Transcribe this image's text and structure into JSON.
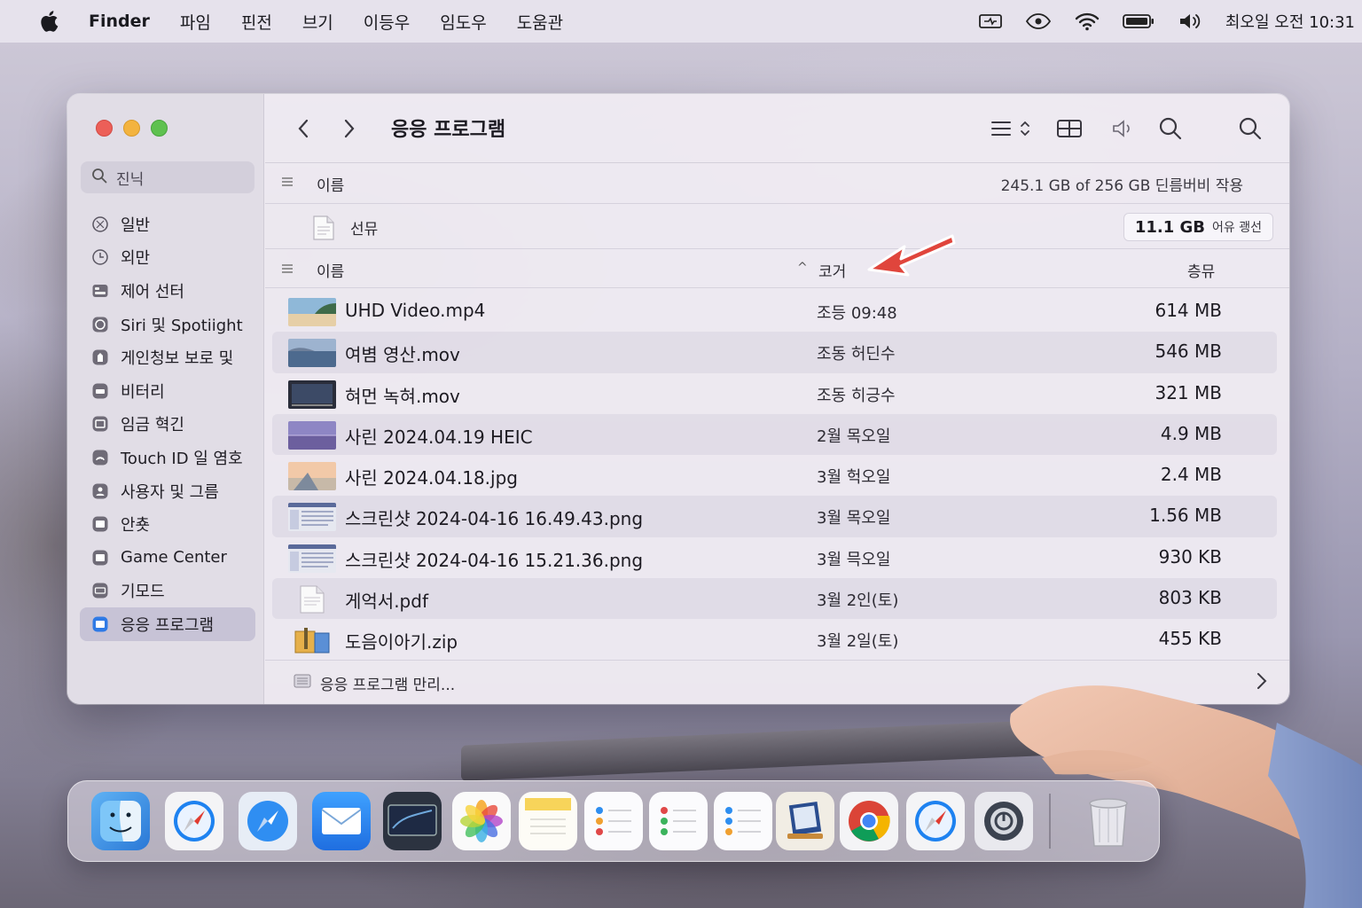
{
  "menubar": {
    "app_name": "Finder",
    "items": [
      "파임",
      "핀전",
      "브기",
      "이등우",
      "임도우",
      "도움관"
    ],
    "clock": "최오일 오전 10:31"
  },
  "sidebar": {
    "search_placeholder": "진닉",
    "items": [
      {
        "label": "일반",
        "icon": "gear-icon"
      },
      {
        "label": "외만",
        "icon": "clock-icon"
      },
      {
        "label": "제어 선터",
        "icon": "control-center-icon"
      },
      {
        "label": "Siri 및 Spotiight",
        "icon": "siri-icon"
      },
      {
        "label": "게인청보 보로 및",
        "icon": "hand-icon"
      },
      {
        "label": "비터리",
        "icon": "battery-icon"
      },
      {
        "label": "임금 혁긴",
        "icon": "lock-icon"
      },
      {
        "label": "Touch ID 일 염호",
        "icon": "fingerprint-icon"
      },
      {
        "label": "사용자 및 그름",
        "icon": "users-icon"
      },
      {
        "label": "안춋",
        "icon": "folder-icon"
      },
      {
        "label": "Game Center",
        "icon": "folder-icon"
      },
      {
        "label": "기모드",
        "icon": "keyboard-icon"
      },
      {
        "label": "응응 프로그램",
        "icon": "applications-icon",
        "active": true
      }
    ]
  },
  "toolbar": {
    "title": "응응 프로그램"
  },
  "header1": {
    "name_label": "이름",
    "storage_text": "245.1 GB of 256 GB  딘름버비 작용"
  },
  "folder_row": {
    "name": "선뮤",
    "badge_big": "11.1 GB",
    "badge_small": "어유 괭선"
  },
  "header2": {
    "name_label": "이름",
    "sort_indicator": "^",
    "size_label": "코거",
    "kind_label": "층뮤"
  },
  "files": [
    {
      "name": "UHD Video.mp4",
      "date": "조등 09:48",
      "size": "614 MB",
      "thumb": "video-beach"
    },
    {
      "name": "여볌 영산.mov",
      "date": "조동 허딘수",
      "size": "546 MB",
      "thumb": "video-lake"
    },
    {
      "name": "혀먼 녹혀.mov",
      "date": "조동 히긍수",
      "size": "321 MB",
      "thumb": "screen-recording"
    },
    {
      "name": "사린 2024.04.19 HEIC",
      "date": "2월 목오일",
      "size": "4.9 MB",
      "thumb": "photo-purple"
    },
    {
      "name": "사린 2024.04.18.jpg",
      "date": "3월 헉오일",
      "size": "2.4 MB",
      "thumb": "photo-sunset"
    },
    {
      "name": "스크린샷 2024-04-16 16.49.43.png",
      "date": "3월 목오일",
      "size": "1.56 MB",
      "thumb": "screenshot"
    },
    {
      "name": "스크린샷 2024-04-16 15.21.36.png",
      "date": "3월 믁오일",
      "size": "930 KB",
      "thumb": "screenshot"
    },
    {
      "name": "게억서.pdf",
      "date": "3월 2인(토)",
      "size": "803 KB",
      "thumb": "document"
    },
    {
      "name": "도음이아기.zip",
      "date": "3월 2일(토)",
      "size": "455 KB",
      "thumb": "archive"
    }
  ],
  "footer": {
    "label": "응응 프로그램 만리..."
  },
  "dock": {
    "apps": [
      "finder-icon",
      "safari-icon",
      "safari-icon",
      "mail-icon",
      "screenshot-app-icon",
      "photos-icon",
      "notes-icon",
      "reminders-icon",
      "reminders-icon",
      "reminders-icon",
      "preview-icon",
      "chrome-icon",
      "safari-icon",
      "disk-utility-icon",
      "trash-icon"
    ]
  },
  "colors": {
    "accent_red": "#e0453c",
    "traffic_red": "#ec5f58",
    "traffic_yellow": "#f3b33f",
    "traffic_green": "#5ec14f"
  }
}
